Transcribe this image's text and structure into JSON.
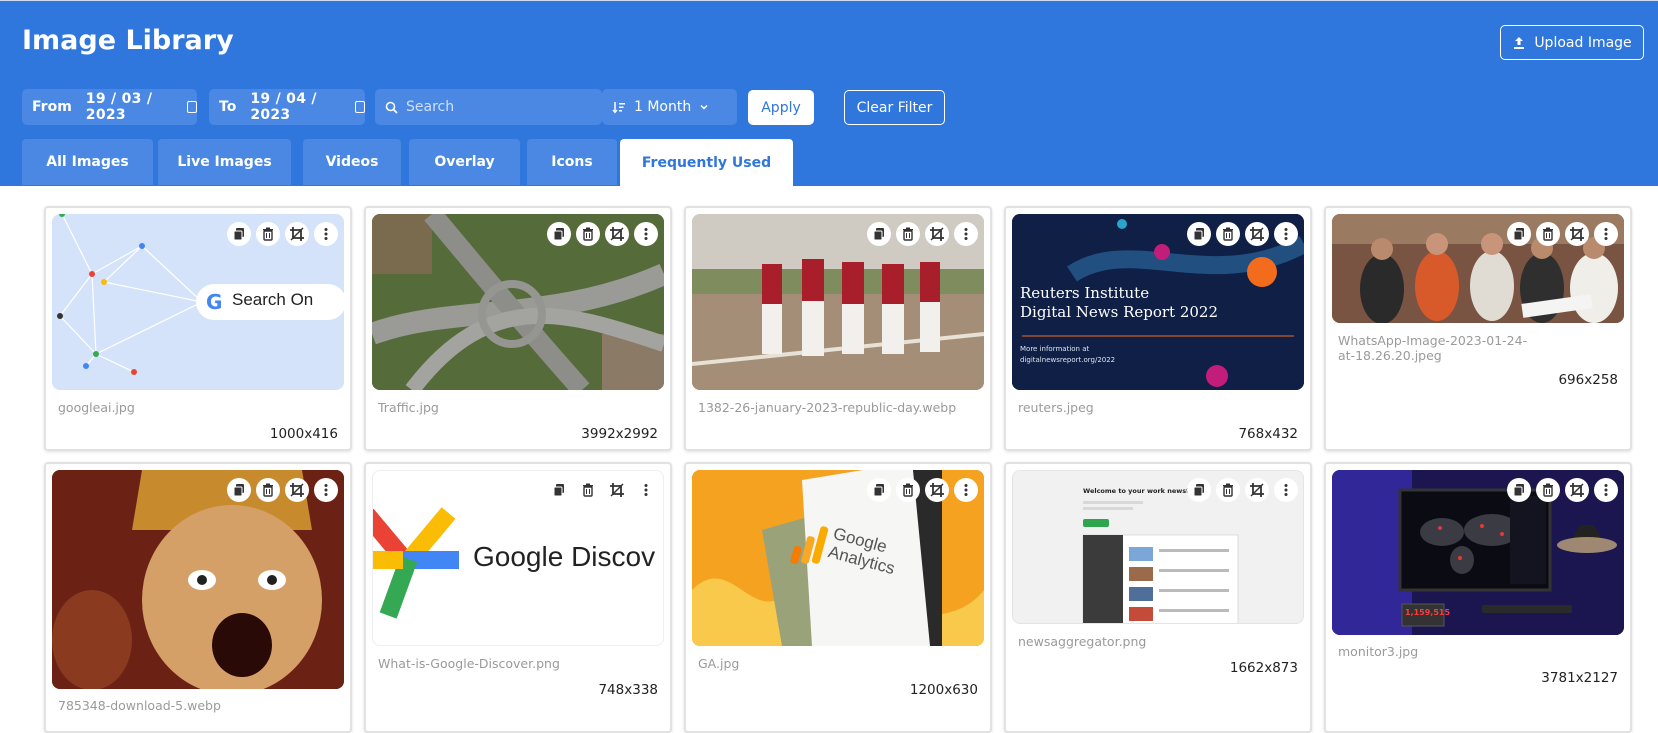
{
  "header": {
    "title": "Image Library",
    "upload_label": "Upload Image"
  },
  "filters": {
    "from_label": "From",
    "from_value": "19 / 03 / 2023",
    "to_label": "To",
    "to_value": "19 / 04 / 2023",
    "search_placeholder": "Search",
    "period_value": "1 Month",
    "apply_label": "Apply",
    "clear_label": "Clear Filter"
  },
  "tabs": [
    {
      "label": "All Images"
    },
    {
      "label": "Live Images"
    },
    {
      "label": "Videos"
    },
    {
      "label": "Overlay"
    },
    {
      "label": "Icons"
    },
    {
      "label": "Frequently Used",
      "active": true
    }
  ],
  "images": [
    {
      "name": "googleai.jpg",
      "dims": "1000x416"
    },
    {
      "name": "Traffic.jpg",
      "dims": "3992x2992"
    },
    {
      "name": "1382-26-january-2023-republic-day.webp",
      "dims": ""
    },
    {
      "name": "reuters.jpeg",
      "dims": "768x432"
    },
    {
      "name": "WhatsApp-Image-2023-01-24-at-18.26.20.jpeg",
      "dims": "696x258"
    },
    {
      "name": "785348-download-5.webp",
      "dims": ""
    },
    {
      "name": "What-is-Google-Discover.png",
      "dims": "748x338"
    },
    {
      "name": "GA.jpg",
      "dims": "1200x630"
    },
    {
      "name": "newsaggregator.png",
      "dims": "1662x873"
    },
    {
      "name": "monitor3.jpg",
      "dims": "3781x2127"
    }
  ],
  "thumb_text": {
    "search_on": "Search On",
    "reuters_line1": "Reuters Institute",
    "reuters_line2": "Digital News Report 2022",
    "reuters_info1": "More information at",
    "reuters_info2": "digitalnewsreport.org/2022",
    "discover": "Google Discov",
    "analytics_line1": "Google",
    "analytics_line2": "Analytics",
    "feed_title": "Welcome to your work newsfeed",
    "monitor_count": "1,159,515"
  },
  "colors": {
    "primary": "#2f76dd",
    "field_bg": "#4a88e4"
  }
}
